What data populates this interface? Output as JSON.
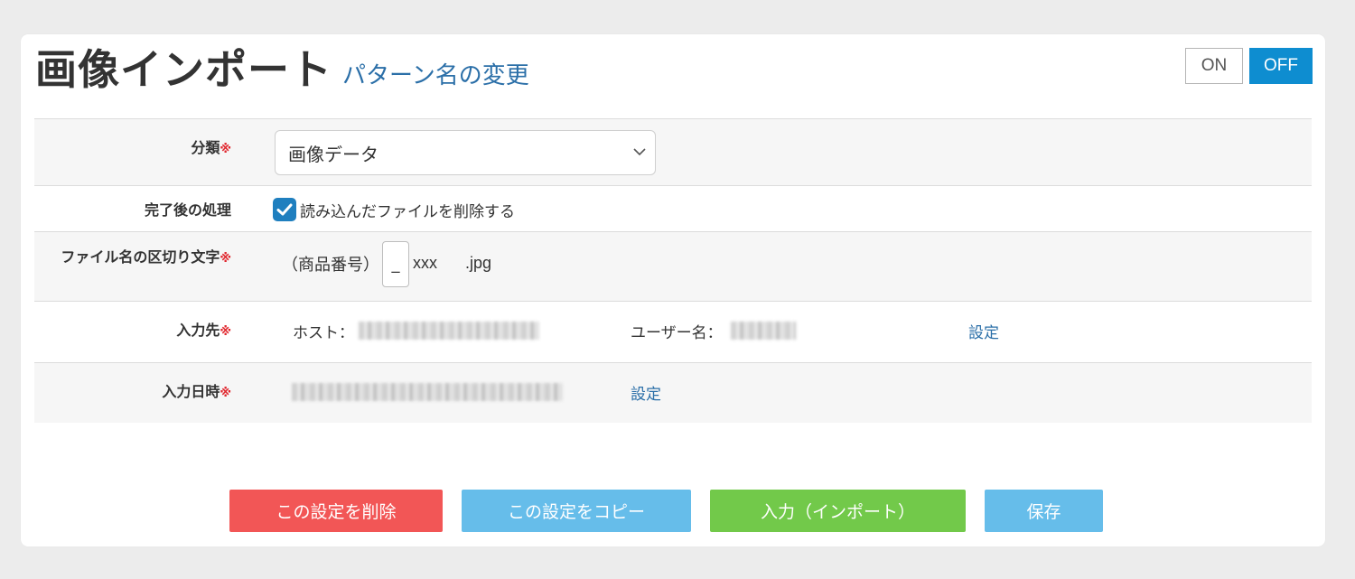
{
  "header": {
    "title": "画像インポート",
    "rename_link": "パターン名の変更",
    "toggle": {
      "on_label": "ON",
      "off_label": "OFF",
      "active": "OFF"
    }
  },
  "required_mark": "※",
  "form": {
    "category": {
      "label": "分類",
      "value": "画像データ"
    },
    "after_complete": {
      "label": "完了後の処理",
      "checkbox_label": "読み込んだファイルを削除する",
      "checked": true
    },
    "separator": {
      "label": "ファイル名の区切り文字",
      "product_label": "（商品番号）",
      "separator_value": "_",
      "suffix": "xxx",
      "extension": ".jpg"
    },
    "destination": {
      "label": "入力先",
      "host_label": "ホスト：",
      "user_label": "ユーザー名：",
      "settings_link": "設定"
    },
    "datetime": {
      "label": "入力日時",
      "settings_link": "設定"
    }
  },
  "actions": {
    "delete": "この設定を削除",
    "copy": "この設定をコピー",
    "import": "入力（インポート）",
    "save": "保存"
  },
  "colors": {
    "accent": "#0e8dd0",
    "link": "#2b6fa8",
    "required": "#e0262d",
    "delete": "#f25656",
    "copy": "#66bdea",
    "import": "#72c94a"
  }
}
